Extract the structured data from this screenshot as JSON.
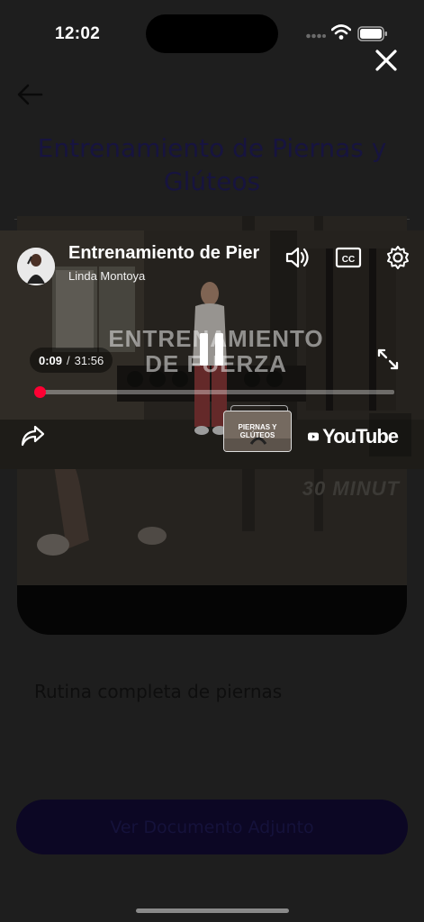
{
  "status_bar": {
    "time": "12:02",
    "icons": [
      "cellular-signal-icon",
      "wifi-icon",
      "battery-icon"
    ]
  },
  "page": {
    "title": "Entrenamiento de Piernas y Glúteos",
    "description": "Rutina completa de piernas",
    "document_button_label": "Ver Documento Adjunto",
    "card_watermark": "30 MINUT"
  },
  "player": {
    "video_title": "Entrenamiento de Piernas y Glúteos",
    "channel_name": "Linda Montoya",
    "overlay_text": "ENTRENAMIENTO DE FUERZA",
    "current_time": "0:09",
    "separator": "/",
    "duration": "31:56",
    "progress": 0.0047,
    "brand": "YouTube",
    "related_video_text": "PIERNAS Y GLÚTEOS",
    "accent_color": "#ff0033",
    "icons": [
      "volume-icon",
      "closed-captions-icon",
      "gear-icon",
      "pause-icon",
      "fullscreen-icon",
      "share-icon",
      "close-icon"
    ]
  }
}
